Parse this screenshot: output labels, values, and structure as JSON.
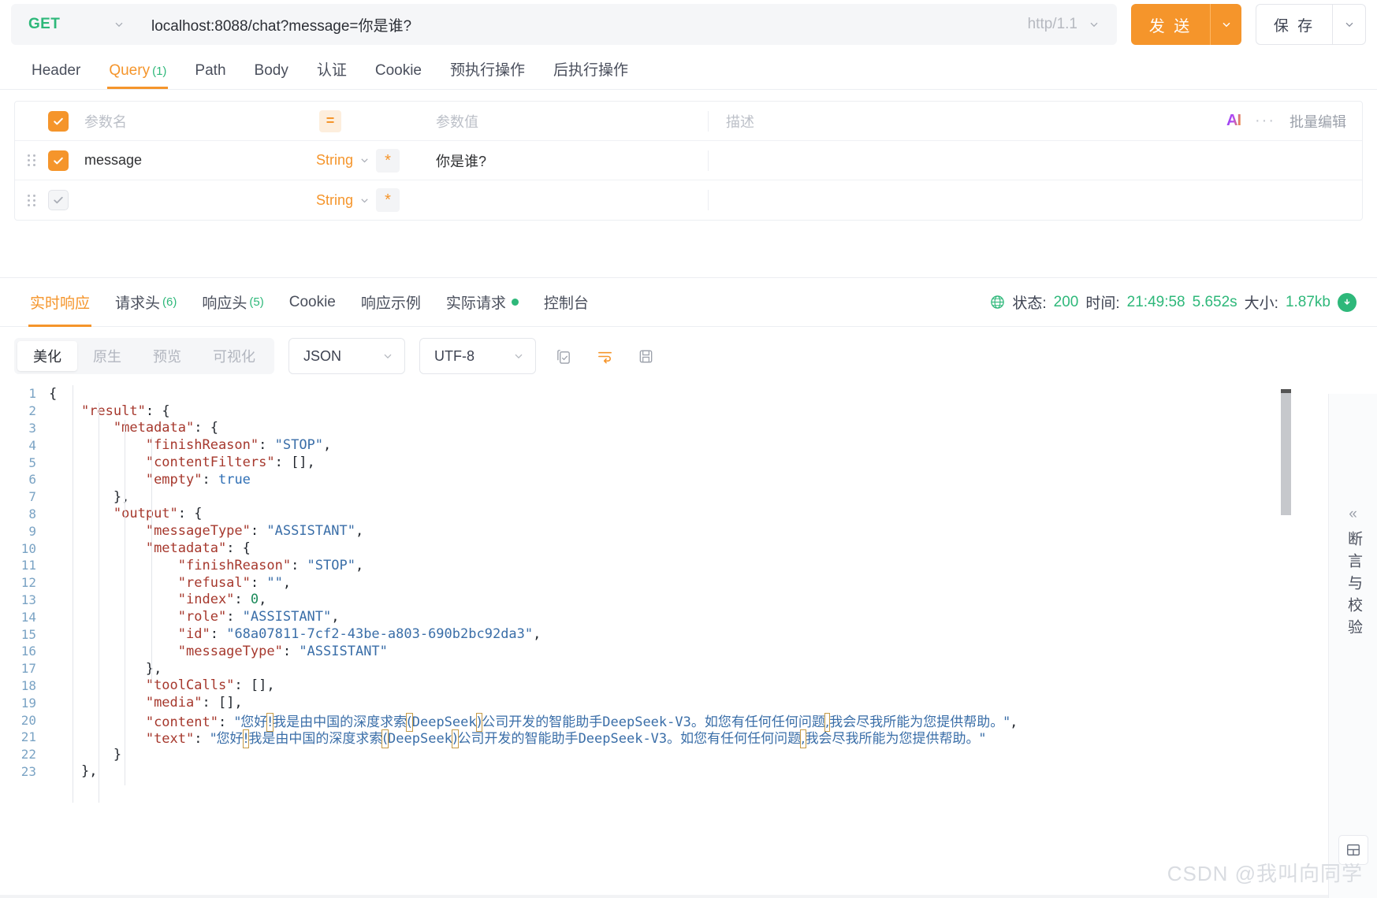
{
  "urlbar": {
    "method": "GET",
    "url": "localhost:8088/chat?message=你是谁?",
    "protocol": "http/1.1",
    "send_label": "发 送",
    "save_label": "保 存"
  },
  "request_tabs": [
    {
      "label": "Header",
      "count": "",
      "active": false
    },
    {
      "label": "Query",
      "count": "(1)",
      "active": true
    },
    {
      "label": "Path",
      "count": "",
      "active": false
    },
    {
      "label": "Body",
      "count": "",
      "active": false
    },
    {
      "label": "认证",
      "count": "",
      "active": false
    },
    {
      "label": "Cookie",
      "count": "",
      "active": false
    },
    {
      "label": "预执行操作",
      "count": "",
      "active": false
    },
    {
      "label": "后执行操作",
      "count": "",
      "active": false
    }
  ],
  "param_table": {
    "header": {
      "name_placeholder": "参数名",
      "value_placeholder": "参数值",
      "desc_placeholder": "描述",
      "eq_badge": "=",
      "ai_label": "AI",
      "more_label": "···",
      "batch_label": "批量编辑"
    },
    "rows": [
      {
        "checked": true,
        "name": "message",
        "type": "String",
        "required": "*",
        "value": "你是谁?",
        "desc": ""
      },
      {
        "checked": false,
        "name": "",
        "type": "String",
        "required": "*",
        "value": "",
        "desc": ""
      }
    ]
  },
  "response_tabs": [
    {
      "label": "实时响应",
      "count": "",
      "dot": false,
      "active": true
    },
    {
      "label": "请求头",
      "count": "(6)",
      "dot": false,
      "active": false
    },
    {
      "label": "响应头",
      "count": "(5)",
      "dot": false,
      "active": false
    },
    {
      "label": "Cookie",
      "count": "",
      "dot": false,
      "active": false
    },
    {
      "label": "响应示例",
      "count": "",
      "dot": false,
      "active": false
    },
    {
      "label": "实际请求",
      "count": "",
      "dot": true,
      "active": false
    },
    {
      "label": "控制台",
      "count": "",
      "dot": false,
      "active": false
    }
  ],
  "status": {
    "status_label": "状态:",
    "status_value": "200",
    "time_label": "时间:",
    "time_value": "21:49:58",
    "duration": "5.652s",
    "size_label": "大小:",
    "size_value": "1.87kb"
  },
  "format_bar": {
    "segments": [
      {
        "label": "美化",
        "active": true
      },
      {
        "label": "原生",
        "active": false
      },
      {
        "label": "预览",
        "active": false
      },
      {
        "label": "可视化",
        "active": false
      }
    ],
    "format_select": "JSON",
    "encoding_select": "UTF-8",
    "icons": [
      "copy-icon",
      "wrap-icon",
      "save-disk-icon"
    ]
  },
  "right_panel": {
    "collapse_label": "«",
    "vertical_label": "断言与校验",
    "layout_icon": "layout-icon"
  },
  "watermark": "CSDN @我叫向同学",
  "code_lines": [
    {
      "n": 1,
      "indent": 0,
      "tokens": [
        {
          "t": "{",
          "c": "p"
        }
      ]
    },
    {
      "n": 2,
      "indent": 1,
      "tokens": [
        {
          "t": "\"result\"",
          "c": "k"
        },
        {
          "t": ": {",
          "c": "p"
        }
      ]
    },
    {
      "n": 3,
      "indent": 2,
      "tokens": [
        {
          "t": "\"metadata\"",
          "c": "k"
        },
        {
          "t": ": {",
          "c": "p"
        }
      ]
    },
    {
      "n": 4,
      "indent": 3,
      "tokens": [
        {
          "t": "\"finishReason\"",
          "c": "k"
        },
        {
          "t": ": ",
          "c": "p"
        },
        {
          "t": "\"STOP\"",
          "c": "s"
        },
        {
          "t": ",",
          "c": "p"
        }
      ]
    },
    {
      "n": 5,
      "indent": 3,
      "tokens": [
        {
          "t": "\"contentFilters\"",
          "c": "k"
        },
        {
          "t": ": [],",
          "c": "p"
        }
      ]
    },
    {
      "n": 6,
      "indent": 3,
      "tokens": [
        {
          "t": "\"empty\"",
          "c": "k"
        },
        {
          "t": ": ",
          "c": "p"
        },
        {
          "t": "true",
          "c": "b"
        }
      ]
    },
    {
      "n": 7,
      "indent": 2,
      "tokens": [
        {
          "t": "},",
          "c": "p"
        }
      ]
    },
    {
      "n": 8,
      "indent": 2,
      "tokens": [
        {
          "t": "\"output\"",
          "c": "k"
        },
        {
          "t": ": {",
          "c": "p"
        }
      ]
    },
    {
      "n": 9,
      "indent": 3,
      "tokens": [
        {
          "t": "\"messageType\"",
          "c": "k"
        },
        {
          "t": ": ",
          "c": "p"
        },
        {
          "t": "\"ASSISTANT\"",
          "c": "s"
        },
        {
          "t": ",",
          "c": "p"
        }
      ]
    },
    {
      "n": 10,
      "indent": 3,
      "tokens": [
        {
          "t": "\"metadata\"",
          "c": "k"
        },
        {
          "t": ": {",
          "c": "p"
        }
      ]
    },
    {
      "n": 11,
      "indent": 4,
      "tokens": [
        {
          "t": "\"finishReason\"",
          "c": "k"
        },
        {
          "t": ": ",
          "c": "p"
        },
        {
          "t": "\"STOP\"",
          "c": "s"
        },
        {
          "t": ",",
          "c": "p"
        }
      ]
    },
    {
      "n": 12,
      "indent": 4,
      "tokens": [
        {
          "t": "\"refusal\"",
          "c": "k"
        },
        {
          "t": ": ",
          "c": "p"
        },
        {
          "t": "\"\"",
          "c": "s"
        },
        {
          "t": ",",
          "c": "p"
        }
      ]
    },
    {
      "n": 13,
      "indent": 4,
      "tokens": [
        {
          "t": "\"index\"",
          "c": "k"
        },
        {
          "t": ": ",
          "c": "p"
        },
        {
          "t": "0",
          "c": "n"
        },
        {
          "t": ",",
          "c": "p"
        }
      ]
    },
    {
      "n": 14,
      "indent": 4,
      "tokens": [
        {
          "t": "\"role\"",
          "c": "k"
        },
        {
          "t": ": ",
          "c": "p"
        },
        {
          "t": "\"ASSISTANT\"",
          "c": "s"
        },
        {
          "t": ",",
          "c": "p"
        }
      ]
    },
    {
      "n": 15,
      "indent": 4,
      "tokens": [
        {
          "t": "\"id\"",
          "c": "k"
        },
        {
          "t": ": ",
          "c": "p"
        },
        {
          "t": "\"68a07811-7cf2-43be-a803-690b2bc92da3\"",
          "c": "s"
        },
        {
          "t": ",",
          "c": "p"
        }
      ]
    },
    {
      "n": 16,
      "indent": 4,
      "tokens": [
        {
          "t": "\"messageType\"",
          "c": "k"
        },
        {
          "t": ": ",
          "c": "p"
        },
        {
          "t": "\"ASSISTANT\"",
          "c": "s"
        }
      ]
    },
    {
      "n": 17,
      "indent": 3,
      "tokens": [
        {
          "t": "},",
          "c": "p"
        }
      ]
    },
    {
      "n": 18,
      "indent": 3,
      "tokens": [
        {
          "t": "\"toolCalls\"",
          "c": "k"
        },
        {
          "t": ": [],",
          "c": "p"
        }
      ]
    },
    {
      "n": 19,
      "indent": 3,
      "tokens": [
        {
          "t": "\"media\"",
          "c": "k"
        },
        {
          "t": ": [],",
          "c": "p"
        }
      ]
    },
    {
      "n": 20,
      "indent": 3,
      "tokens": [
        {
          "t": "\"content\"",
          "c": "k"
        },
        {
          "t": ": ",
          "c": "p"
        },
        {
          "t": "\"您好",
          "c": "cn"
        },
        {
          "t": "!",
          "c": "cn",
          "hl": true
        },
        {
          "t": "我是由中国的深度求索",
          "c": "cn"
        },
        {
          "t": "(",
          "c": "cn",
          "hl": true
        },
        {
          "t": "DeepSeek",
          "c": "s"
        },
        {
          "t": ")",
          "c": "cn",
          "hl": true
        },
        {
          "t": "公司开发的智能助手",
          "c": "cn"
        },
        {
          "t": "DeepSeek-V3",
          "c": "s"
        },
        {
          "t": "。如您有任何任何问题",
          "c": "cn"
        },
        {
          "t": ",",
          "c": "cn",
          "hl": true
        },
        {
          "t": "我会尽我所能为您提供帮助。\"",
          "c": "cn"
        },
        {
          "t": ",",
          "c": "p"
        }
      ]
    },
    {
      "n": 21,
      "indent": 3,
      "tokens": [
        {
          "t": "\"text\"",
          "c": "k"
        },
        {
          "t": ": ",
          "c": "p"
        },
        {
          "t": "\"您好",
          "c": "cn"
        },
        {
          "t": "!",
          "c": "cn",
          "hl": true
        },
        {
          "t": "我是由中国的深度求索",
          "c": "cn"
        },
        {
          "t": "(",
          "c": "cn",
          "hl": true
        },
        {
          "t": "DeepSeek",
          "c": "s"
        },
        {
          "t": ")",
          "c": "cn",
          "hl": true
        },
        {
          "t": "公司开发的智能助手",
          "c": "cn"
        },
        {
          "t": "DeepSeek-V3",
          "c": "s"
        },
        {
          "t": "。如您有任何任何问题",
          "c": "cn"
        },
        {
          "t": ",",
          "c": "cn",
          "hl": true
        },
        {
          "t": "我会尽我所能为您提供帮助。\"",
          "c": "cn"
        }
      ]
    },
    {
      "n": 22,
      "indent": 2,
      "tokens": [
        {
          "t": "}",
          "c": "p"
        }
      ]
    },
    {
      "n": 23,
      "indent": 1,
      "tokens": [
        {
          "t": "},",
          "c": "p"
        }
      ]
    }
  ]
}
